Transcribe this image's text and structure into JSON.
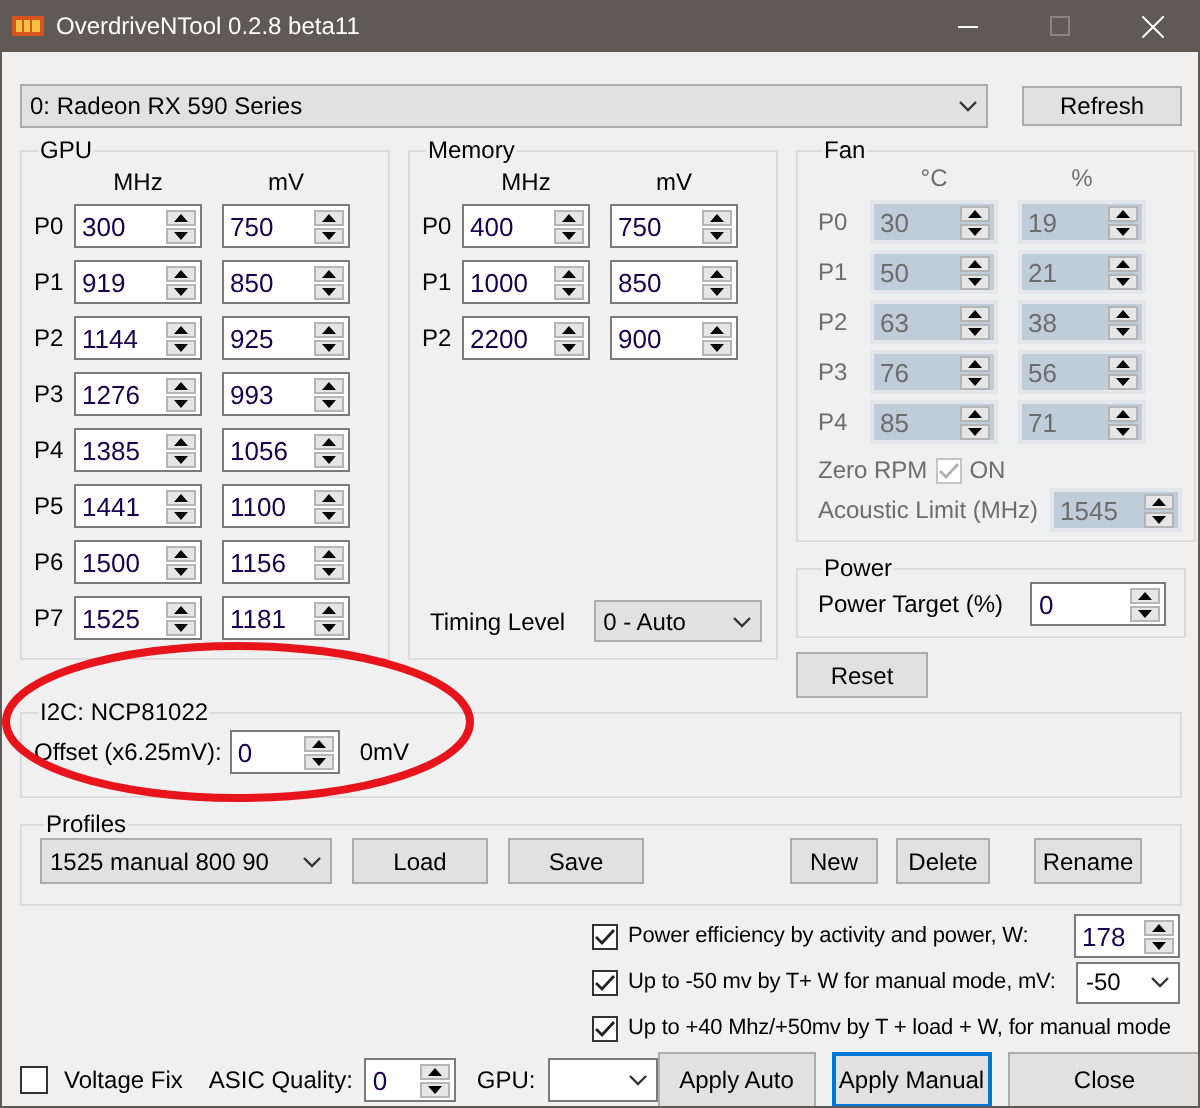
{
  "window": {
    "title": "OverdriveNTool 0.2.8 beta11"
  },
  "device": {
    "value": "0: Radeon RX 590 Series"
  },
  "refresh_button": "Refresh",
  "gpu": {
    "title": "GPU",
    "columns": [
      "MHz",
      "mV"
    ],
    "rows": [
      {
        "label": "P0",
        "values": [
          "300",
          "750"
        ]
      },
      {
        "label": "P1",
        "values": [
          "919",
          "850"
        ]
      },
      {
        "label": "P2",
        "values": [
          "1144",
          "925"
        ]
      },
      {
        "label": "P3",
        "values": [
          "1276",
          "993"
        ]
      },
      {
        "label": "P4",
        "values": [
          "1385",
          "1056"
        ]
      },
      {
        "label": "P5",
        "values": [
          "1441",
          "1100"
        ]
      },
      {
        "label": "P6",
        "values": [
          "1500",
          "1156"
        ]
      },
      {
        "label": "P7",
        "values": [
          "1525",
          "1181"
        ]
      }
    ]
  },
  "memory": {
    "title": "Memory",
    "columns": [
      "MHz",
      "mV"
    ],
    "rows": [
      {
        "label": "P0",
        "values": [
          "400",
          "750"
        ]
      },
      {
        "label": "P1",
        "values": [
          "1000",
          "850"
        ]
      },
      {
        "label": "P2",
        "values": [
          "2200",
          "900"
        ]
      }
    ],
    "timing": {
      "label": "Timing Level",
      "value": "0 - Auto"
    }
  },
  "fan": {
    "title": "Fan",
    "disabled": true,
    "columns": [
      "°C",
      "%"
    ],
    "rows": [
      {
        "label": "P0",
        "values": [
          "30",
          "19"
        ]
      },
      {
        "label": "P1",
        "values": [
          "50",
          "21"
        ]
      },
      {
        "label": "P2",
        "values": [
          "63",
          "38"
        ]
      },
      {
        "label": "P3",
        "values": [
          "76",
          "56"
        ]
      },
      {
        "label": "P4",
        "values": [
          "85",
          "71"
        ]
      }
    ],
    "zero_rpm": {
      "label": "Zero RPM",
      "checked": true,
      "text": "ON"
    },
    "acoustic": {
      "label": "Acoustic Limit (MHz)",
      "value": "1545"
    }
  },
  "power": {
    "title": "Power",
    "label": "Power Target (%)",
    "value": "0"
  },
  "reset_button": "Reset",
  "i2c": {
    "title": "I2C: NCP81022",
    "label": "Offset (x6.25mV):",
    "value": "0",
    "reading": "0mV"
  },
  "profiles": {
    "title": "Profiles",
    "value": "1525 manual 800 90",
    "left_buttons": [
      "Load",
      "Save"
    ],
    "right_buttons": [
      "New",
      "Delete",
      "Rename"
    ]
  },
  "options": [
    {
      "kind": "spin",
      "label": "Power efficiency by activity and power, W:",
      "checked": true,
      "value": "178"
    },
    {
      "kind": "select",
      "label": "Up to -50 mv by T+ W  for manual mode, mV:",
      "checked": true,
      "value": "-50"
    },
    {
      "kind": "plain",
      "label": "Up to +40 Mhz/+50mv by T +  load + W, for manual mode",
      "checked": true
    }
  ],
  "voltage_fix": {
    "label": "Voltage Fix",
    "checked": false
  },
  "asic": {
    "label": "ASIC Quality:",
    "value": "0"
  },
  "gpu_select": {
    "label": "GPU:"
  },
  "actions": [
    {
      "label": "Apply Auto",
      "focused": false
    },
    {
      "label": "Apply Manual",
      "focused": true
    },
    {
      "label": "Close",
      "focused": false
    }
  ]
}
